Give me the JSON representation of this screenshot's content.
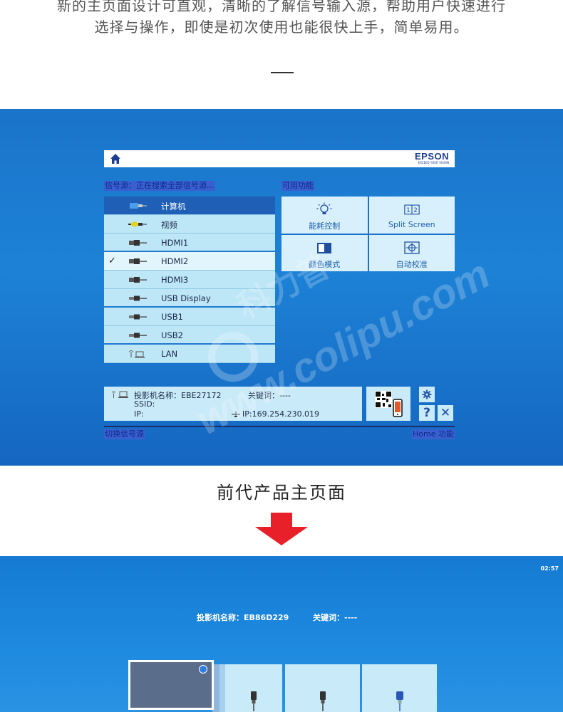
{
  "intro": {
    "line1": "新的主页面设计可直观，清晰的了解信号输入源，帮助用户快速进行",
    "line2": "选择与操作，即使是初次使用也能很快上手，简单易用。"
  },
  "panel1": {
    "brand": "EPSON",
    "brand_tagline": "EXCEED YOUR VISION",
    "source_label": "信号源：正在搜索全部信号源...",
    "function_label": "可用功能",
    "sources": [
      {
        "label": "计算机",
        "icon": "vga-connector-icon"
      },
      {
        "label": "视频",
        "icon": "rca-connector-icon"
      },
      {
        "label": "HDMI1",
        "icon": "hdmi-connector-icon"
      },
      {
        "label": "HDMI2",
        "icon": "hdmi-connector-icon",
        "check": "✓"
      },
      {
        "label": "HDMI3",
        "icon": "hdmi-connector-icon"
      },
      {
        "label": "USB Display",
        "icon": "usb-connector-icon"
      },
      {
        "label": "USB1",
        "icon": "usb-connector-icon"
      },
      {
        "label": "USB2",
        "icon": "usb-connector-icon"
      },
      {
        "label": "LAN",
        "icon": "lan-icon"
      }
    ],
    "functions": [
      {
        "label": "能耗控制",
        "icon": "bulb-icon"
      },
      {
        "label": "Split Screen",
        "icon": "split-screen-icon"
      },
      {
        "label": "颜色模式",
        "icon": "color-mode-icon"
      },
      {
        "label": "自动校准",
        "icon": "auto-calibration-icon"
      }
    ],
    "info": {
      "projector_name": "投影机名称：EBE27172",
      "keyword": "关键词：----",
      "ssid": "SSID:",
      "ip": "IP:",
      "ip_wired": "IP:169.254.230.019"
    },
    "help_label": "?",
    "close_label": "✕",
    "footer_left": "切换信号源",
    "footer_right": "Home 功能"
  },
  "caption": "前代产品主页面",
  "panel2": {
    "clock": "02:57",
    "projector_name": "投影机名称：EB86D229",
    "keyword": "关键词：----"
  },
  "colors": {
    "panel_blue": "#1a74c9",
    "list_bg": "#bde6f7",
    "selected_bg": "#1f60b6",
    "arrow_red": "#e8202a",
    "brand_blue": "#1b3e93"
  }
}
